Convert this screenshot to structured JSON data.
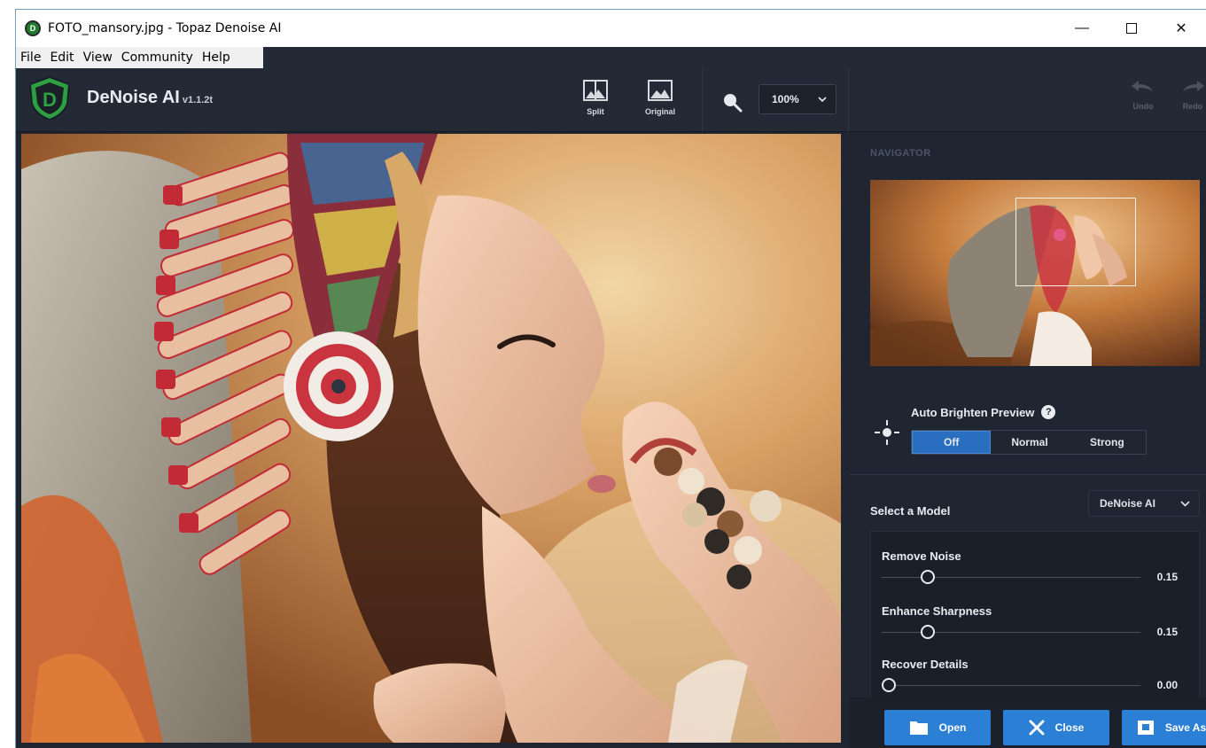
{
  "window": {
    "title": "FOTO_mansory.jpg - Topaz Denoise AI",
    "controls": {
      "minimize": "—",
      "close": "✕"
    }
  },
  "menu": [
    "File",
    "Edit",
    "View",
    "Community",
    "Help"
  ],
  "toolbar": {
    "brand": "DeNoise AI",
    "version": "v1.1.2t",
    "split_label": "Split",
    "original_label": "Original",
    "zoom_value": "100%",
    "undo_label": "Undo",
    "redo_label": "Redo"
  },
  "navigator": {
    "title": "NAVIGATOR"
  },
  "brighten": {
    "label": "Auto Brighten Preview",
    "help": "?",
    "options": [
      "Off",
      "Normal",
      "Strong"
    ],
    "selected": "Off"
  },
  "model": {
    "label": "Select a Model",
    "value": "DeNoise AI"
  },
  "sliders": [
    {
      "label": "Remove Noise",
      "value": "0.15",
      "fraction": 0.15
    },
    {
      "label": "Enhance Sharpness",
      "value": "0.15",
      "fraction": 0.15
    },
    {
      "label": "Recover Details",
      "value": "0.00",
      "fraction": 0.0
    }
  ],
  "actions": {
    "open": "Open",
    "close": "Close",
    "save_as": "Save As"
  },
  "colors": {
    "accent": "#2b7fd4",
    "panel_bg": "#1f2632",
    "toolbar_bg": "#232a36",
    "logo_green": "#2ea043"
  }
}
